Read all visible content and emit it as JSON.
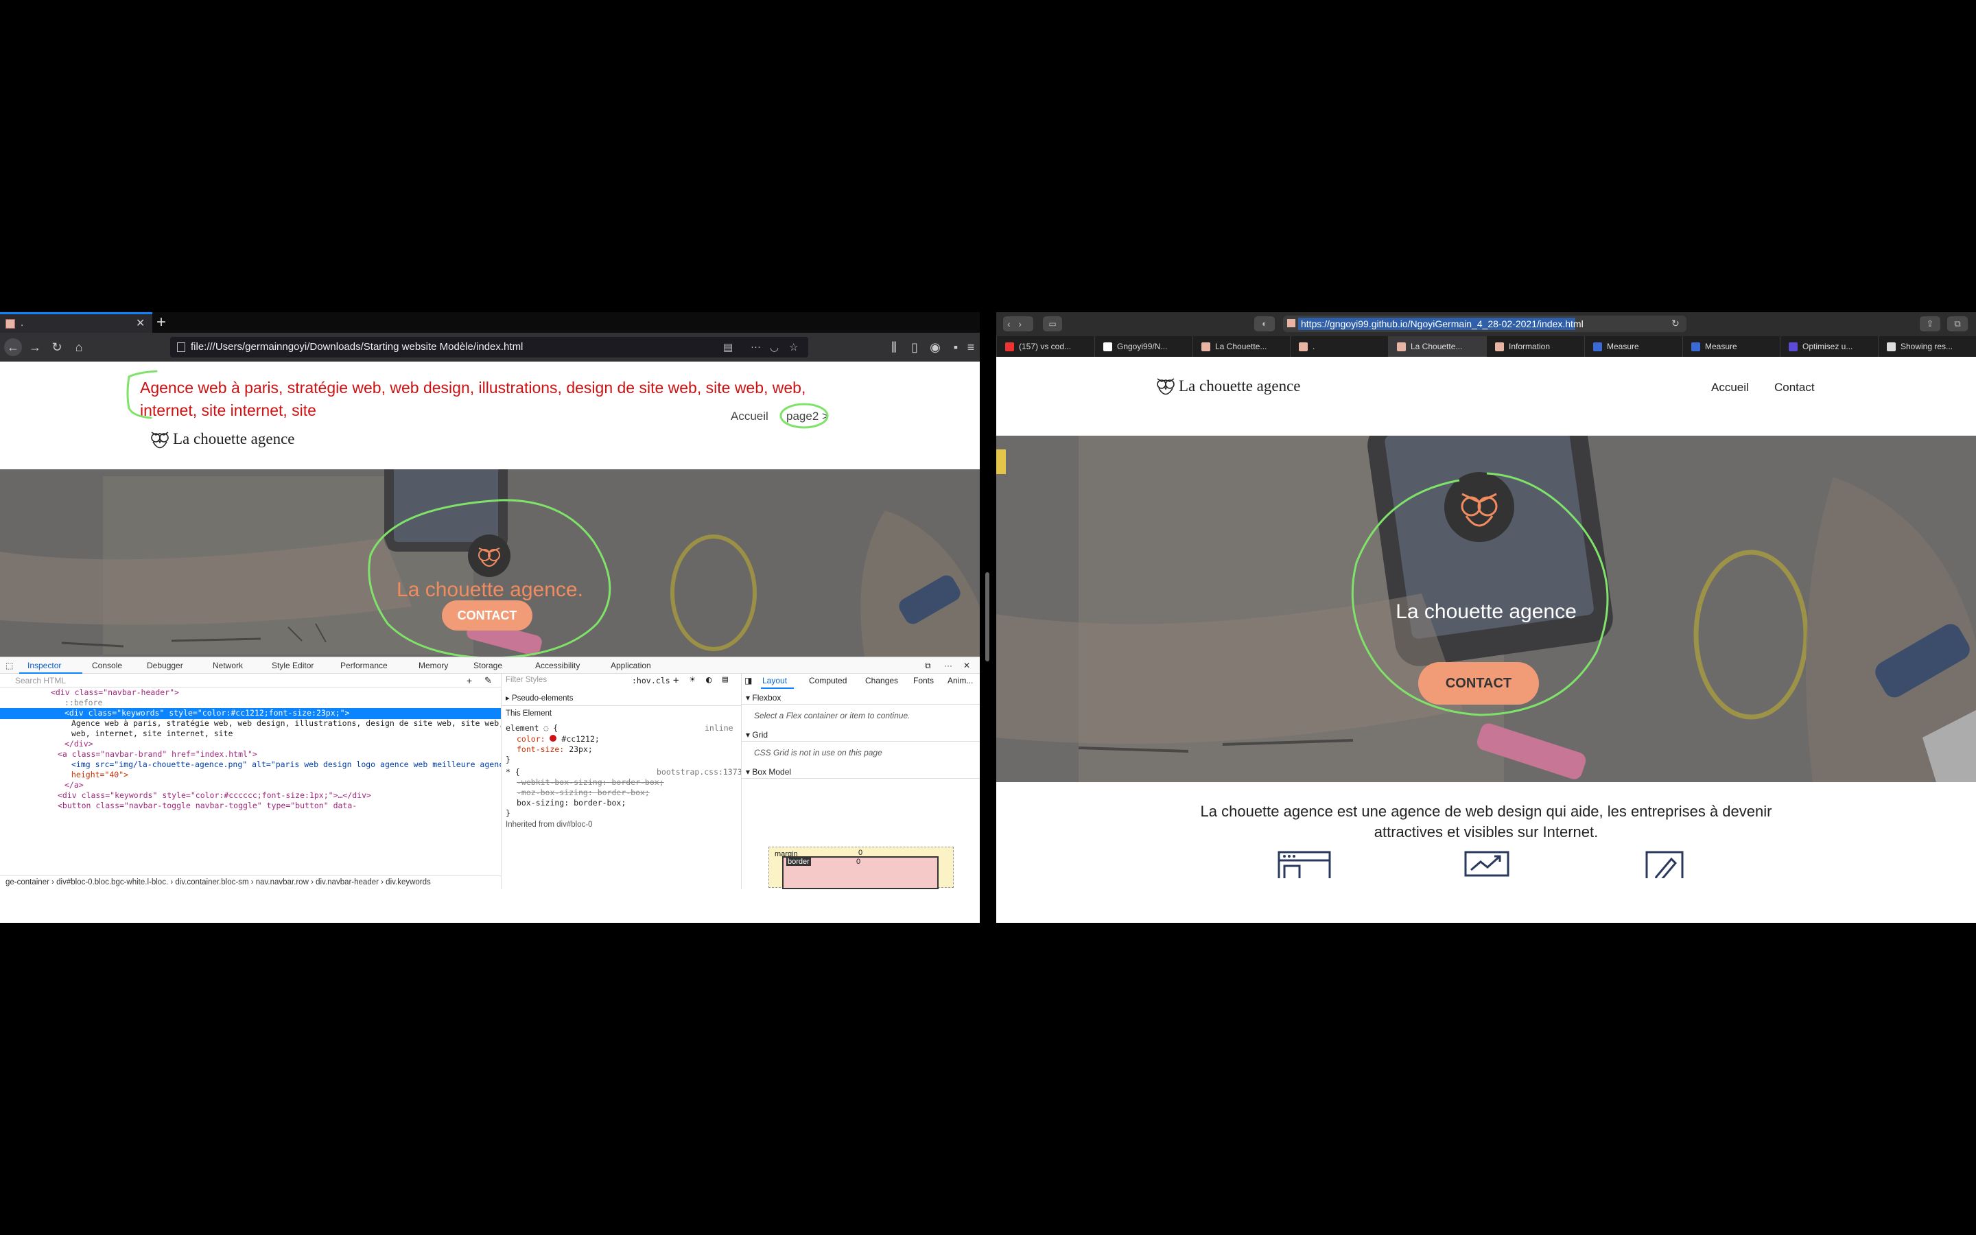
{
  "left_browser": {
    "tab": {
      "title": ".",
      "new_tab": "+"
    },
    "url": "file:///Users/germainngoyi/Downloads/Starting website Modèle/index.html",
    "page": {
      "keywords": "Agence web à paris, stratégie web, web design, illustrations, design de site web, site web, web, internet, site internet, site",
      "nav_accueil": "Accueil",
      "nav_page2": "page2 >",
      "brand": "La chouette agence",
      "hero_title": "La chouette agence.",
      "contact_button": "CONTACT"
    },
    "devtools": {
      "tabs": [
        "Inspector",
        "Console",
        "Debugger",
        "Network",
        "Style Editor",
        "Performance",
        "Memory",
        "Storage",
        "Accessibility",
        "Application"
      ],
      "search_placeholder": "Search HTML",
      "html_lines": [
        "<div class=\"navbar-header\">",
        "::before",
        "<div class=\"keywords\" style=\"color:#cc1212;font-size:23px;\">",
        "Agence web à paris, stratégie web, web design, illustrations, design de site web, site web,",
        "web, internet, site internet, site",
        "</div>",
        "<a class=\"navbar-brand\" href=\"index.html\">",
        "<img src=\"img/la-chouette-agence.png\" alt=\"paris web design logo agence web meilleure agence\"",
        "height=\"40\">",
        "</a>",
        "<div class=\"keywords\" style=\"color:#cccccc;font-size:1px;\">…</div>",
        "<button class=\"navbar-toggle navbar-toggle\" type=\"button\" data-"
      ],
      "breadcrumbs": "ge-container  ›  div#bloc-0.bloc.bgc-white.l-bloc.  ›  div.container.bloc-sm  ›  nav.navbar.row  ›  div.navbar-header  ›  div.keywords",
      "styles": {
        "filter_placeholder": "Filter Styles",
        "hov": ":hov",
        "cls": ".cls",
        "pseudo_elements": "Pseudo-elements",
        "this_element": "This Element",
        "element_rule": "element",
        "inline": "inline",
        "color_decl": "color:",
        "color_val": "#cc1212;",
        "font_decl": "font-size:",
        "font_val": "23px;",
        "universal_rule": "* {",
        "bootstrap_src": "bootstrap.css:1373",
        "webkit_box": "-webkit-box-sizing: border-box;",
        "moz_box": "-moz-box-sizing: border-box;",
        "box_sizing": "box-sizing: border-box;",
        "inherited": "Inherited from div#bloc-0"
      },
      "layout": {
        "tabs": [
          "Layout",
          "Computed",
          "Changes",
          "Fonts",
          "Anim..."
        ],
        "flexbox": "Flexbox",
        "flexbox_msg": "Select a Flex container or item to continue.",
        "grid": "Grid",
        "grid_msg": "CSS Grid is not in use on this page",
        "box_model": "Box Model",
        "margin": "margin",
        "border": "border",
        "zero": "0"
      }
    }
  },
  "right_browser": {
    "url": "https://gngoyi99.github.io/NgoyiGermain_4_28-02-2021/index.html",
    "tabs": [
      {
        "label": "(157) vs cod...",
        "color": "#e33"
      },
      {
        "label": "Gngoyi99/N...",
        "color": "#fff"
      },
      {
        "label": "La Chouette...",
        "color": "#e8b4a4"
      },
      {
        "label": ".",
        "color": "#e8b4a4"
      },
      {
        "label": "La Chouette...",
        "color": "#e8b4a4"
      },
      {
        "label": "Information",
        "color": "#e8b4a4"
      },
      {
        "label": "Measure",
        "color": "#3a6ad6"
      },
      {
        "label": "Measure",
        "color": "#3a6ad6"
      },
      {
        "label": "Optimisez u...",
        "color": "#5b4bd6"
      },
      {
        "label": "Showing res...",
        "color": "#ddd"
      }
    ],
    "active_tab_index": 4,
    "page": {
      "brand": "La chouette agence",
      "nav_accueil": "Accueil",
      "nav_contact": "Contact",
      "hero_title": "La chouette agence",
      "contact_button": "CONTACT",
      "intro": "La chouette agence est une agence de web design qui aide, les entreprises à devenir attractives et visibles sur Internet."
    }
  },
  "colors": {
    "keywords_red": "#cc1212",
    "accent_orange": "#f29c77",
    "annotation_green": "#7fe36a",
    "devtools_selection": "#0a84ff"
  }
}
